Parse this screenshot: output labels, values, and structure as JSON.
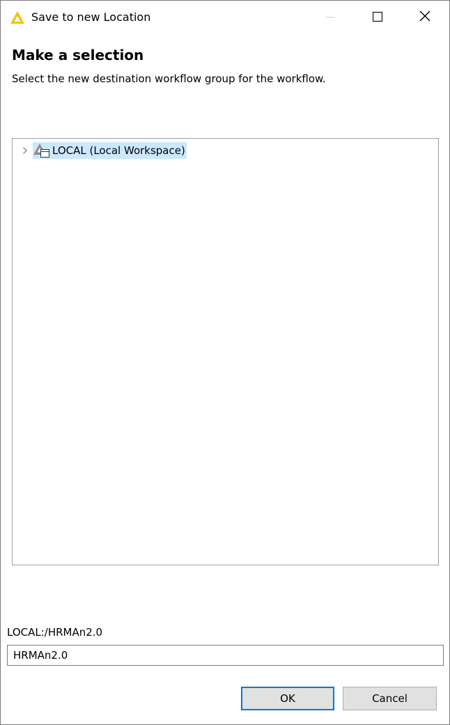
{
  "window": {
    "title": "Save to new Location",
    "controls": {
      "minimize": "minimize",
      "maximize": "maximize",
      "close": "close"
    }
  },
  "header": {
    "title": "Make a selection",
    "description": "Select the new destination workflow group for the workflow."
  },
  "tree": {
    "items": [
      {
        "label": "LOCAL (Local Workspace)",
        "icon": "local-workspace-icon",
        "expanded": false,
        "selected": true
      }
    ]
  },
  "destination": {
    "path_label": "LOCAL:/HRMAn2.0",
    "name_value": "HRMAn2.0"
  },
  "buttons": {
    "ok": "OK",
    "cancel": "Cancel"
  },
  "colors": {
    "selection": "#cce8ff",
    "default_button_border": "#0078d7",
    "app_icon": "#f5c400"
  }
}
